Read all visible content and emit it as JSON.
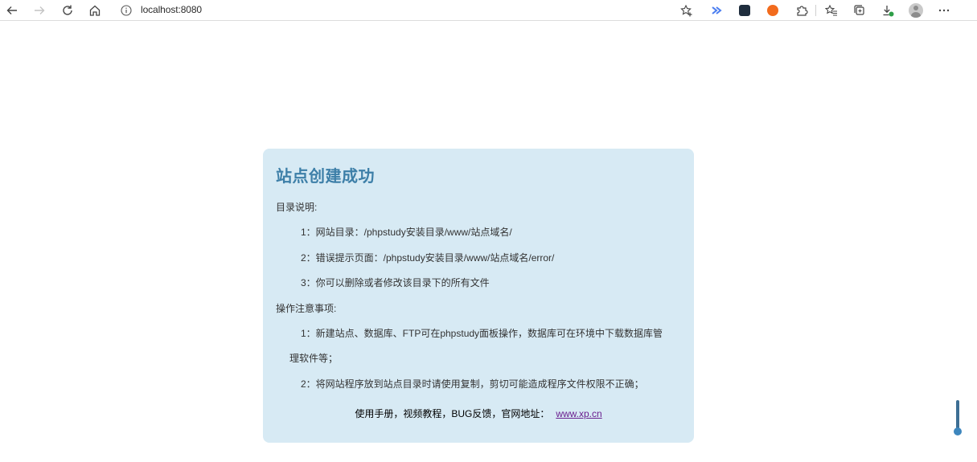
{
  "browser": {
    "address": "localhost:8080",
    "icons": {
      "back": "back-arrow-icon",
      "forward": "forward-arrow-icon",
      "refresh": "refresh-icon",
      "home": "home-icon",
      "info": "info-icon",
      "favorite_add": "add-favorite-icon",
      "collections": "collections-icon",
      "downloads": "download-icon",
      "more": "more-icon"
    },
    "colors": {
      "ext_blue": "#4a7df0",
      "ext_dark": "#1f2d3d",
      "ext_orange": "#f26b1d"
    }
  },
  "card": {
    "title": "站点创建成功",
    "dir_heading": "目录说明:",
    "dir_items": [
      "1：网站目录：/phpstudy安装目录/www/站点域名/",
      "2：错误提示页面：/phpstudy安装目录/www/站点域名/error/",
      "3：你可以删除或者修改该目录下的所有文件"
    ],
    "notes_heading": "操作注意事项:",
    "notes_items": [
      "1：新建站点、数据库、FTP可在phpstudy面板操作，数据库可在环境中下载数据库管",
      "理软件等；",
      "2：将网站程序放到站点目录时请使用复制，剪切可能造成程序文件权限不正确；"
    ],
    "footer_text": "使用手册，视频教程，BUG反馈，官网地址：",
    "footer_link": "www.xp.cn",
    "colors": {
      "background": "#d7eaf4",
      "title": "#3d7fa8",
      "link": "#6a1f8f"
    }
  }
}
